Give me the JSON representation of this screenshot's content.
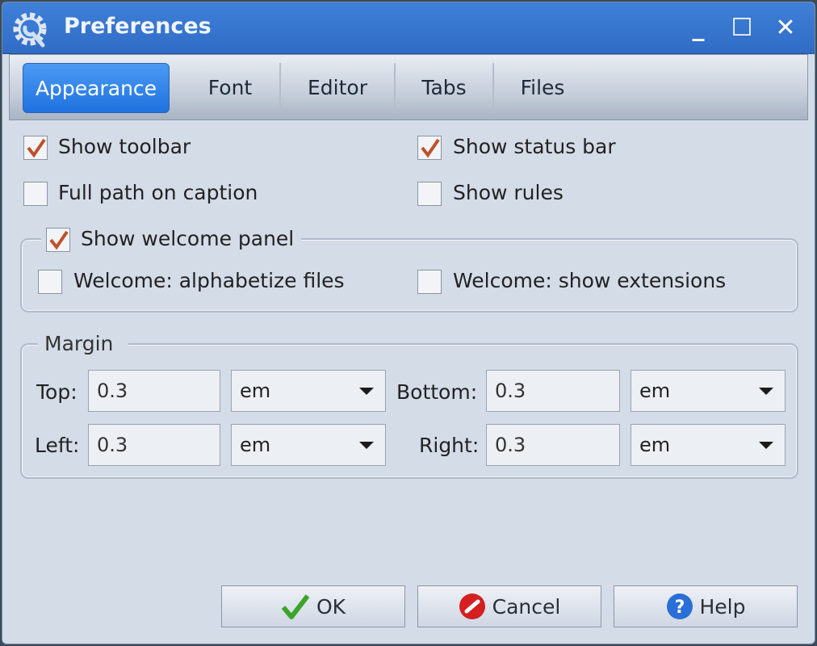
{
  "window": {
    "title": "Preferences",
    "icon": "gear-wrench-icon",
    "controls": [
      "minimize",
      "maximize",
      "close"
    ]
  },
  "tabs": [
    {
      "label": "Appearance",
      "active": true
    },
    {
      "label": "Font"
    },
    {
      "label": "Editor"
    },
    {
      "label": "Tabs"
    },
    {
      "label": "Files"
    }
  ],
  "options": {
    "show_toolbar": {
      "label": "Show toolbar",
      "checked": true
    },
    "show_status_bar": {
      "label": "Show status bar",
      "checked": true
    },
    "full_path": {
      "label": "Full path on caption",
      "checked": false
    },
    "show_rules": {
      "label": "Show rules",
      "checked": false
    }
  },
  "welcome": {
    "show_welcome_panel": {
      "label": "Show welcome panel",
      "checked": true
    },
    "alphabetize": {
      "label": "Welcome: alphabetize files",
      "checked": false
    },
    "extensions": {
      "label": "Welcome: show extensions",
      "checked": false
    }
  },
  "margin": {
    "title": "Margin",
    "top": {
      "label": "Top:",
      "value": "0.3",
      "unit": "em"
    },
    "bottom": {
      "label": "Bottom:",
      "value": "0.3",
      "unit": "em"
    },
    "left": {
      "label": "Left:",
      "value": "0.3",
      "unit": "em"
    },
    "right": {
      "label": "Right:",
      "value": "0.3",
      "unit": "em"
    }
  },
  "buttons": {
    "ok": "OK",
    "cancel": "Cancel",
    "help": "Help"
  },
  "colors": {
    "title_bar": "#3478d4",
    "active_tab": "#2a7ae8",
    "check": "#c0502a"
  }
}
